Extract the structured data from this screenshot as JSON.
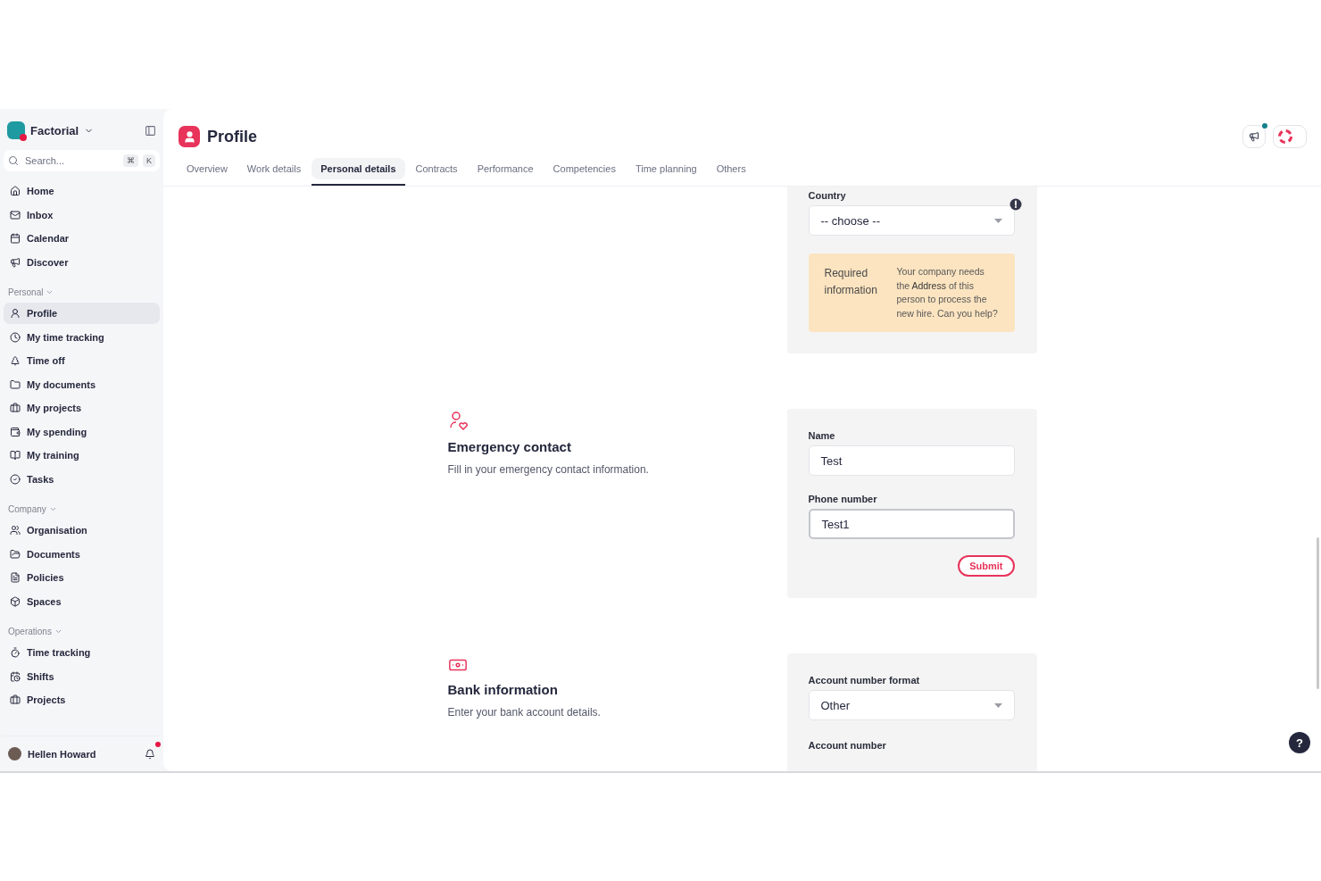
{
  "sidebar": {
    "brand": "Factorial",
    "search": {
      "placeholder": "Search...",
      "keys": [
        "⌘",
        "K"
      ]
    },
    "top_items": [
      {
        "label": "Home",
        "selected": false
      },
      {
        "label": "Inbox",
        "selected": false
      },
      {
        "label": "Calendar",
        "selected": false
      },
      {
        "label": "Discover",
        "selected": false
      }
    ],
    "groups": [
      {
        "title": "Personal",
        "items": [
          {
            "label": "Profile",
            "selected": true
          },
          {
            "label": "My time tracking",
            "selected": false
          },
          {
            "label": "Time off",
            "selected": false
          },
          {
            "label": "My documents",
            "selected": false
          },
          {
            "label": "My projects",
            "selected": false
          },
          {
            "label": "My spending",
            "selected": false
          },
          {
            "label": "My training",
            "selected": false
          },
          {
            "label": "Tasks",
            "selected": false
          }
        ]
      },
      {
        "title": "Company",
        "items": [
          {
            "label": "Organisation",
            "selected": false
          },
          {
            "label": "Documents",
            "selected": false
          },
          {
            "label": "Policies",
            "selected": false
          },
          {
            "label": "Spaces",
            "selected": false
          }
        ]
      },
      {
        "title": "Operations",
        "items": [
          {
            "label": "Time tracking",
            "selected": false
          },
          {
            "label": "Shifts",
            "selected": false
          },
          {
            "label": "Projects",
            "selected": false
          }
        ]
      }
    ],
    "user": {
      "name": "Hellen Howard",
      "unread": true
    }
  },
  "header": {
    "title": "Profile",
    "announcements_unread": true
  },
  "tabs": [
    {
      "label": "Overview",
      "selected": false
    },
    {
      "label": "Work details",
      "selected": false
    },
    {
      "label": "Personal details",
      "selected": true
    },
    {
      "label": "Contracts",
      "selected": false
    },
    {
      "label": "Performance",
      "selected": false
    },
    {
      "label": "Competencies",
      "selected": false
    },
    {
      "label": "Time planning",
      "selected": false
    },
    {
      "label": "Others",
      "selected": false
    }
  ],
  "sections": [
    {
      "kind": "address",
      "fields": [
        {
          "label": "Country",
          "kind": "select",
          "value": "-- choose --",
          "warning": true
        }
      ],
      "notice": {
        "title": "Required information",
        "text": "Your company needs the **Address** of this person to process the new hire. Can you help?"
      }
    },
    {
      "kind": "emergency",
      "title": "Emergency contact",
      "description": "Fill in your emergency contact information.",
      "fields": [
        {
          "label": "Name",
          "kind": "text",
          "value": "Test",
          "focused": false
        },
        {
          "label": "Phone number",
          "kind": "text",
          "value": "Test1",
          "focused": true
        }
      ],
      "submit": "Submit"
    },
    {
      "kind": "bank",
      "title": "Bank information",
      "description": "Enter your bank account details.",
      "fields": [
        {
          "label": "Account number format",
          "kind": "select",
          "value": "Other"
        }
      ],
      "next_label": "Account number"
    }
  ],
  "help": "?"
}
